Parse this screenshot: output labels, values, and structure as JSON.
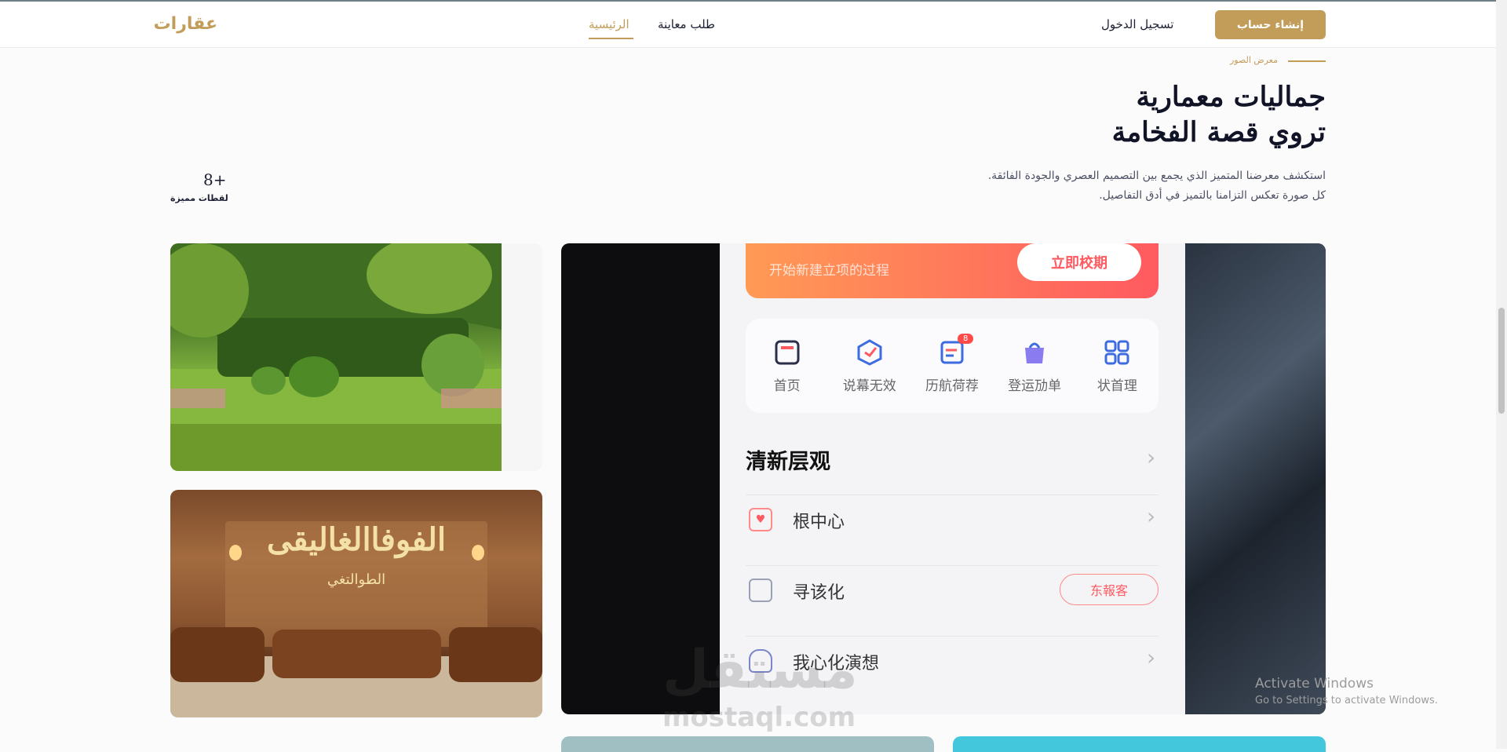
{
  "navbar": {
    "logo": "عقارات",
    "links": {
      "home": "الرئيسية",
      "inspection": "طلب معاينة"
    },
    "login": "تسجيل الدخول",
    "register": "إنشاء حساب"
  },
  "section": {
    "eyebrow": "معرض الصور",
    "title_line1": "جماليات معمارية",
    "title_line2": "تروي قصة الفخامة",
    "desc_line1": "استكشف معرضنا المتميز الذي يجمع بين التصميم العصري والجودة الفائقة.",
    "desc_line2": "كل صورة تعكس التزامنا بالتميز في أدق التفاصيل.",
    "stat_value": "8+",
    "stat_label": "لقطات مميزة"
  },
  "gallery": {
    "hall_sign_main": "الفوفاالغاليقى",
    "hall_sign_sub": "الطوالتغي",
    "phone": {
      "banner_button": "立即校期",
      "banner_text": "开始新建立项的过程",
      "icons": [
        "首页",
        "说幕无效",
        "历航荷荐",
        "登运劢单",
        "状首理"
      ],
      "badge": "8",
      "section_title": "清新层观",
      "rows": [
        "根中心",
        "寻该化",
        "我心化演想"
      ],
      "row_action": "东報客"
    }
  },
  "overlay": {
    "watermark_ar": "مستقل",
    "watermark_en": "mostaql.com",
    "activate_title": "Activate Windows",
    "activate_sub": "Go to Settings to activate Windows."
  },
  "colors": {
    "accent": "#c29d5a",
    "text": "#1c1f33",
    "background": "#fbfbfc"
  }
}
